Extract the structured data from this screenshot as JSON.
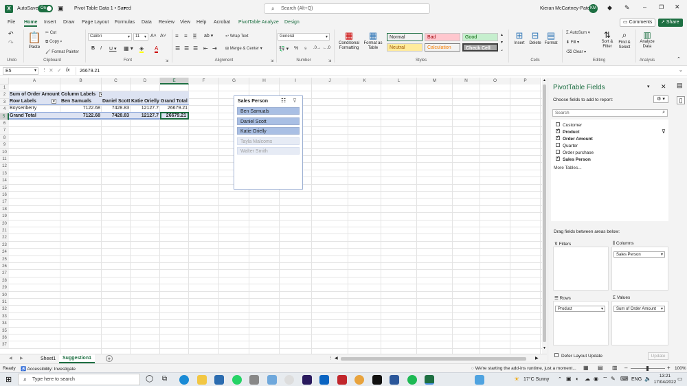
{
  "title_bar": {
    "autosave_label": "AutoSave",
    "autosave_state": "On",
    "doc_title": "Pivot Table Data 1 • Saved",
    "search_placeholder": "Search (Alt+Q)",
    "user_name": "Kieran McCartney-Patel",
    "user_initials": "KM"
  },
  "menu": {
    "items": [
      "File",
      "Home",
      "Insert",
      "Draw",
      "Page Layout",
      "Formulas",
      "Data",
      "Review",
      "View",
      "Help",
      "Acrobat",
      "PivotTable Analyze",
      "Design"
    ],
    "active": "Home",
    "comments_label": "Comments",
    "share_label": "Share"
  },
  "ribbon": {
    "undo_label": "Undo",
    "paste_label": "Paste",
    "cut_label": "Cut",
    "copy_label": "Copy",
    "format_painter_label": "Format Painter",
    "clipboard_label": "Clipboard",
    "font_name": "Calibri",
    "font_size": "11",
    "font_label": "Font",
    "wrap_text_label": "Wrap Text",
    "merge_center_label": "Merge & Center",
    "alignment_label": "Alignment",
    "number_format": "General",
    "number_label": "Number",
    "conditional_formatting_label": "Conditional Formatting",
    "format_as_table_label": "Format as Table",
    "styles": [
      {
        "label": "Normal",
        "bg": "#ffffff",
        "fg": "#222222"
      },
      {
        "label": "Bad",
        "bg": "#ffc7ce",
        "fg": "#9c0006"
      },
      {
        "label": "Good",
        "bg": "#c6efce",
        "fg": "#006100"
      },
      {
        "label": "Neutral",
        "bg": "#ffeb9c",
        "fg": "#9c5700"
      },
      {
        "label": "Calculation",
        "bg": "#f2f2f2",
        "fg": "#fa7d00"
      },
      {
        "label": "Check Cell",
        "bg": "#a5a5a5",
        "fg": "#ffffff"
      }
    ],
    "styles_label": "Styles",
    "insert_label": "Insert",
    "delete_label": "Delete",
    "format_label": "Format",
    "cells_label": "Cells",
    "autosum_label": "AutoSum",
    "fill_label": "Fill",
    "clear_label": "Clear",
    "sort_filter_label": "Sort & Filter",
    "find_select_label": "Find & Select",
    "editing_label": "Editing",
    "analyze_data_label": "Analyze Data",
    "analysis_label": "Analysis"
  },
  "formula_bar": {
    "name_box": "E5",
    "fx": "fx",
    "formula": "26679.21"
  },
  "grid": {
    "columns": [
      "A",
      "B",
      "C",
      "D",
      "E",
      "F",
      "G",
      "H",
      "I",
      "J",
      "K",
      "L",
      "M",
      "N",
      "O",
      "P"
    ],
    "selected_column": "E",
    "selected_row": "5",
    "rows": [
      "1",
      "2",
      "3",
      "4",
      "5",
      "6",
      "7",
      "8",
      "9",
      "10",
      "11",
      "12",
      "13",
      "14",
      "15",
      "16",
      "17",
      "18",
      "19",
      "20",
      "21",
      "22",
      "23",
      "24",
      "25",
      "26",
      "27",
      "28",
      "29",
      "30",
      "31",
      "32",
      "33",
      "34",
      "35",
      "36",
      "37"
    ]
  },
  "pivot": {
    "sum_label": "Sum of Order Amount",
    "column_labels": "Column Labels",
    "row_labels": "Row Labels",
    "headers": [
      "Ben Samuals",
      "Daniel Scott",
      "Katie Orielly",
      "Grand Total"
    ],
    "rows": [
      {
        "label": "Boysenberry",
        "values": [
          "7122.68",
          "7428.83",
          "12127.7",
          "26679.21"
        ]
      },
      {
        "label": "Grand Total",
        "values": [
          "7122.68",
          "7428.83",
          "12127.7",
          "26679.21"
        ]
      }
    ]
  },
  "slicer": {
    "title": "Sales Person",
    "items": [
      {
        "label": "Ben Samuals",
        "selected": true
      },
      {
        "label": "Daniel Scott",
        "selected": true
      },
      {
        "label": "Katie Orielly",
        "selected": true
      },
      {
        "label": "Tayla Malcoms",
        "selected": false
      },
      {
        "label": "Walter Smith",
        "selected": false
      }
    ]
  },
  "pivot_pane": {
    "title": "PivotTable Fields",
    "choose_label": "Choose fields to add to report:",
    "search_placeholder": "Search",
    "fields": [
      {
        "label": "Customer",
        "checked": false
      },
      {
        "label": "Product",
        "checked": true
      },
      {
        "label": "Order Amount",
        "checked": true
      },
      {
        "label": "Quarter",
        "checked": false
      },
      {
        "label": "Order purchase",
        "checked": false
      },
      {
        "label": "Sales Person",
        "checked": true
      }
    ],
    "more_tables": "More Tables...",
    "drag_label": "Drag fields between areas below:",
    "filters_label": "Filters",
    "columns_label": "Columns",
    "columns_value": "Sales Person",
    "rows_label": "Rows",
    "rows_value": "Product",
    "values_label": "Values",
    "values_value": "Sum of Order Amount",
    "defer_label": "Defer Layout Update",
    "update_label": "Update"
  },
  "sheets": {
    "tabs": [
      "Sheet1",
      "Suggestion1"
    ],
    "active": "Suggestion1"
  },
  "status": {
    "ready": "Ready",
    "accessibility": "Accessibility: Investigate",
    "message": "We're starting the add-ins runtime, just a moment...",
    "zoom": "100%"
  },
  "taskbar": {
    "search_placeholder": "Type here to search",
    "weather": "17°C  Sunny",
    "lang": "ENG",
    "time": "13:21",
    "date": "17/04/2022"
  }
}
